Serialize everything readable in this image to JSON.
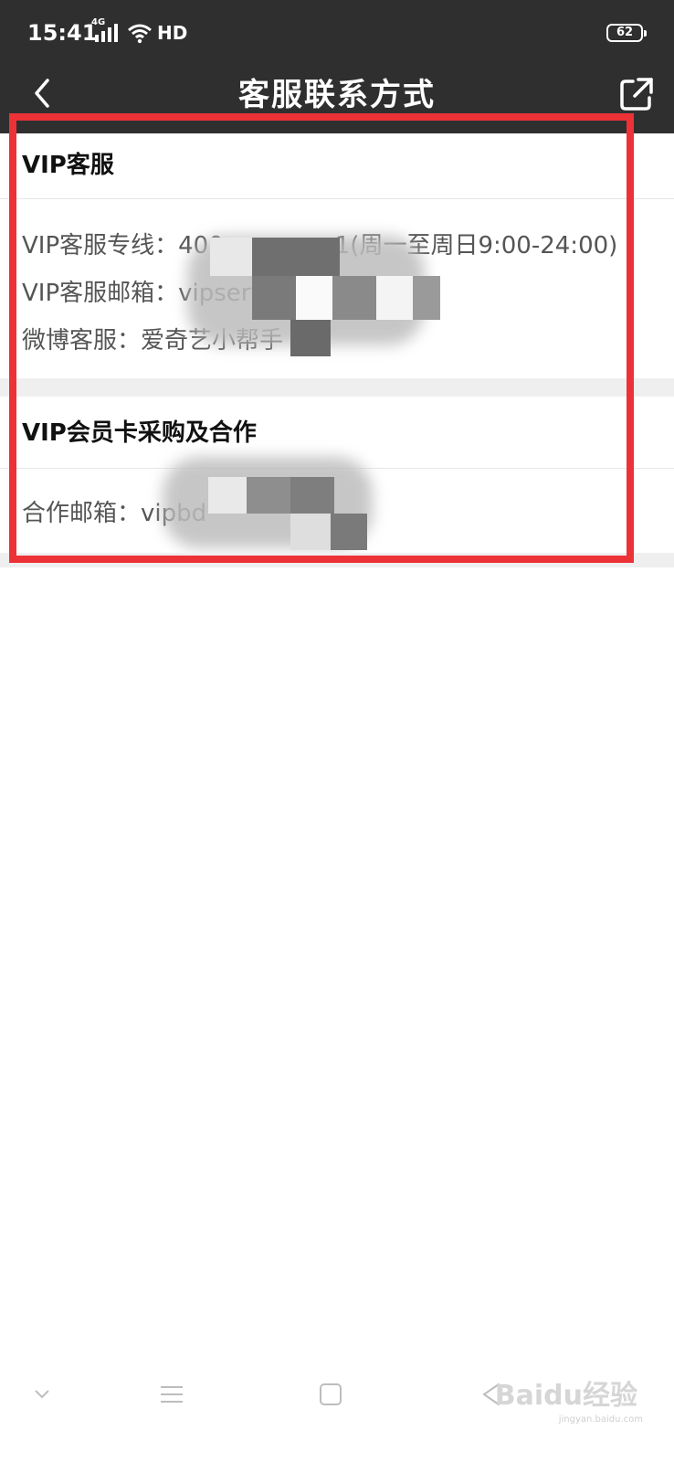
{
  "status_bar": {
    "time": "15:41",
    "network": "4G",
    "hd": "HD",
    "battery": "62"
  },
  "header": {
    "title": "客服联系方式",
    "back_icon": "chevron-left-icon",
    "share_icon": "share-icon"
  },
  "vip_service": {
    "title": "VIP客服",
    "hotline": "VIP客服专线：400",
    "hotline_suffix": "1(周一至周日9:00-24:00)",
    "email": "VIP客服邮箱：vipservice@qiyi.com",
    "weibo": "微博客服：爱奇艺小帮手"
  },
  "vip_card": {
    "title": "VIP会员卡采购及合作",
    "email": "合作邮箱：vipbd"
  },
  "watermark": {
    "brand": "Baidu经验",
    "url": "jingyan.baidu.com"
  },
  "colors": {
    "header_bg": "#2f2f2f",
    "highlight": "#ec3237"
  }
}
